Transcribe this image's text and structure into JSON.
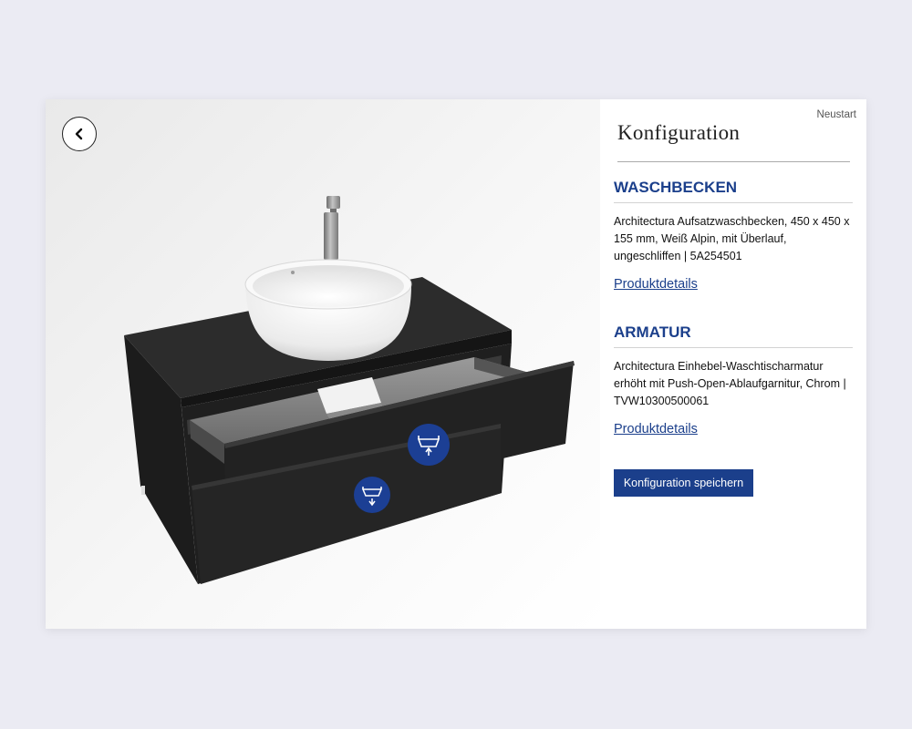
{
  "viewer": {
    "back_icon": "chevron-left-icon",
    "hotspots": [
      {
        "icon": "drawer-open-icon"
      },
      {
        "icon": "drawer-close-icon"
      }
    ],
    "accent_color": "#1c3f94"
  },
  "panel": {
    "restart_label": "Neustart",
    "title": "Konfiguration",
    "sections": [
      {
        "heading": "WASCHBECKEN",
        "description": "Architectura Aufsatzwaschbecken, 450 x 450 x 155 mm, Weiß Alpin, mit Überlauf, ungeschliffen | 5A254501",
        "link_label": "Produktdetails"
      },
      {
        "heading": "ARMATUR",
        "description": "Architectura Einhebel-Waschtischarmatur erhöht mit Push-Open-Ablaufgarnitur, Chrom | TVW10300500061",
        "link_label": "Produktdetails"
      }
    ],
    "save_label": "Konfiguration speichern"
  },
  "colors": {
    "page_background": "#ebebf3",
    "accent": "#1b3f8b",
    "cabinet": "#2a2a2a"
  }
}
